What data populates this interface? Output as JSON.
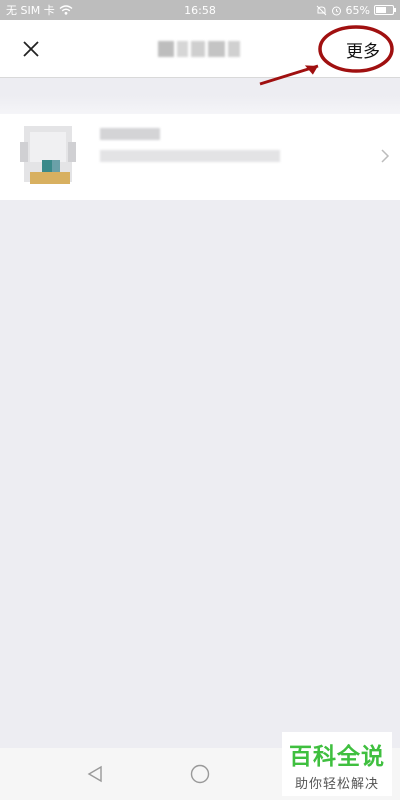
{
  "status_bar": {
    "carrier": "无 SIM 卡",
    "time": "16:58",
    "battery_percent": "65%",
    "battery_level": 0.65,
    "icons": [
      "wifi-icon",
      "silent-bell-icon",
      "alarm-icon",
      "battery-icon"
    ]
  },
  "header": {
    "close_icon": "close-icon",
    "more_label": "更多"
  },
  "annotation": {
    "color": "#a01010"
  },
  "list_item": {
    "chevron_icon": "chevron-right-icon"
  },
  "nav": {
    "icons": [
      "back-triangle-icon",
      "home-circle-icon"
    ]
  },
  "watermark": {
    "title": "百科全说",
    "subtitle": "助你轻松解决"
  },
  "colors": {
    "background": "#ededf2",
    "card": "#ffffff",
    "status_bar": "#bdbdbd",
    "watermark_green": "#3fbf3f"
  }
}
